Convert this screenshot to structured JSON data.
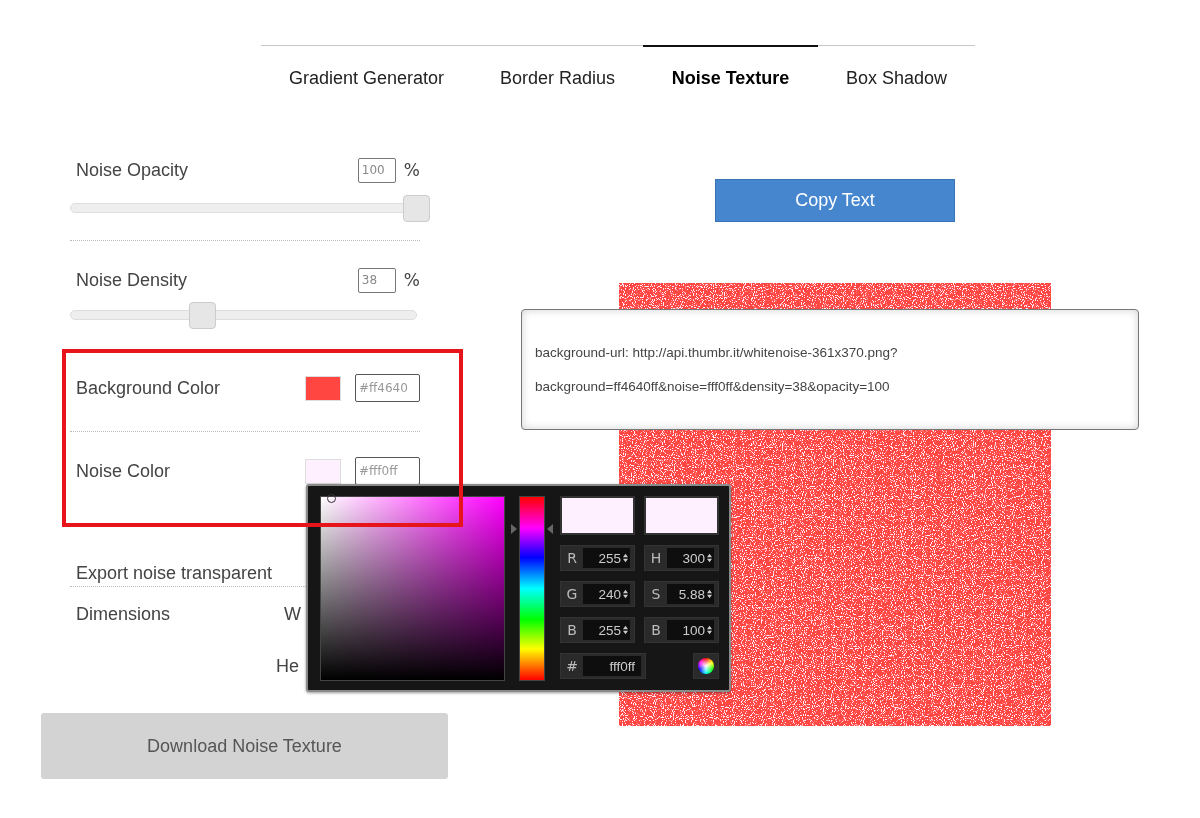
{
  "tabs": [
    {
      "label": "Gradient Generator",
      "selected": false
    },
    {
      "label": "Border Radius",
      "selected": false
    },
    {
      "label": "Noise Texture",
      "selected": true
    },
    {
      "label": "Box Shadow",
      "selected": false
    }
  ],
  "controls": [
    {
      "kind": "slider",
      "label": "Noise Opacity",
      "value": "100",
      "unit": "%",
      "level": 1
    },
    {
      "kind": "slider",
      "label": "Noise Density",
      "value": "38",
      "unit": "%",
      "level": 0.38
    },
    {
      "kind": "color",
      "label": "Background Color",
      "color": "#ff4640",
      "value": "#ff4640"
    },
    {
      "kind": "color",
      "label": "Noise Color",
      "color": "#fff0ff",
      "value": "#fff0ff"
    },
    {
      "kind": "toggle",
      "label": "Export noise transparent"
    },
    {
      "kind": "dimensions",
      "label": "Dimensions",
      "fields": [
        "W",
        "He"
      ]
    }
  ],
  "download_button": "Download Noise Texture",
  "copy_button": "Copy Text",
  "code_lines": [
    "background-url: http://api.thumbr.it/whitenoise-361x370.png?",
    "background=ff4640ff&noise=fff0ff&density=38&opacity=100"
  ],
  "highlight_frame": true,
  "color_picker": {
    "swatches": [
      {
        "color": "#fff0ff"
      },
      {
        "color": "#fff0ff"
      }
    ],
    "fields": [
      {
        "label": "R",
        "value": "255"
      },
      {
        "label": "H",
        "value": "300"
      },
      {
        "label": "G",
        "value": "240"
      },
      {
        "label": "S",
        "value": "5.88"
      },
      {
        "label": "B",
        "value": "255"
      },
      {
        "label": "B",
        "value": "100"
      }
    ],
    "hex": {
      "label": "#",
      "value": "fff0ff"
    }
  }
}
